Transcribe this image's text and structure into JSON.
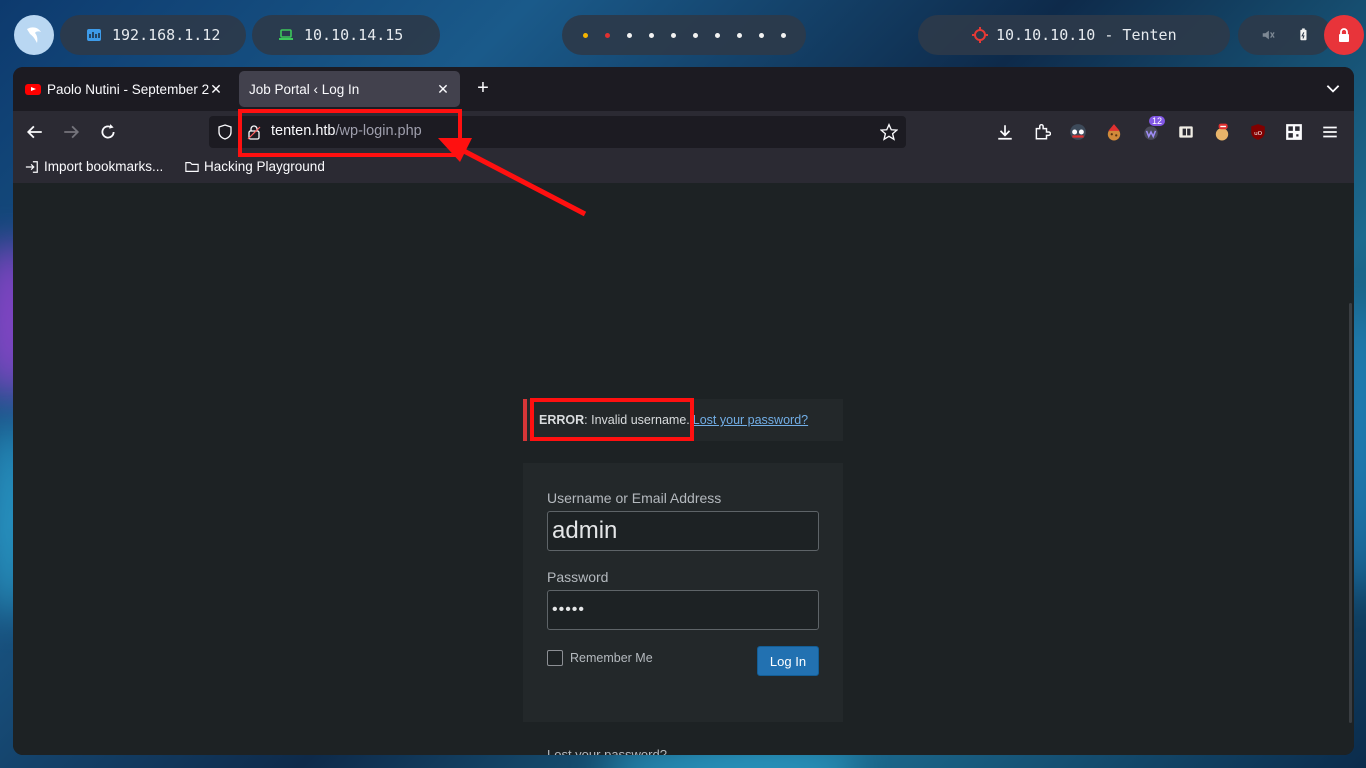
{
  "panel": {
    "ip_local": "192.168.1.12",
    "ip_vpn": "10.10.14.15",
    "target": "10.10.10.10 - Tenten",
    "workspaces": [
      {
        "color": "#f5b400"
      },
      {
        "color": "#e03030"
      },
      {
        "color": "#f2f2f2"
      },
      {
        "color": "#f2f2f2"
      },
      {
        "color": "#f2f2f2"
      },
      {
        "color": "#f2f2f2"
      },
      {
        "color": "#f2f2f2"
      },
      {
        "color": "#f2f2f2"
      },
      {
        "color": "#f2f2f2"
      },
      {
        "color": "#f2f2f2"
      }
    ]
  },
  "browser": {
    "tabs": [
      {
        "label": "Paolo Nutini - September 2",
        "icon": "youtube-icon",
        "active": false
      },
      {
        "label": "Job Portal ‹ Log In",
        "icon": "",
        "active": true
      }
    ],
    "url_host": "tenten.htb",
    "url_path": "/wp-login.php",
    "extension_badge": "12",
    "bookmarks": [
      {
        "label": "Import bookmarks...",
        "icon": "import-icon"
      },
      {
        "label": "Hacking Playground",
        "icon": "folder-icon"
      }
    ]
  },
  "login": {
    "error_strong": "ERROR",
    "error_text": ": Invalid username.",
    "error_link": "Lost your password?",
    "username_label": "Username or Email Address",
    "username_value": "admin",
    "password_label": "Password",
    "password_value": "•••••",
    "remember_label": "Remember Me",
    "submit_label": "Log In",
    "lost_password": "Lost your password?"
  },
  "colors": {
    "annotation": "#ff1010",
    "error_border": "#d63638",
    "button": "#2271b1",
    "link": "#72aee6"
  }
}
